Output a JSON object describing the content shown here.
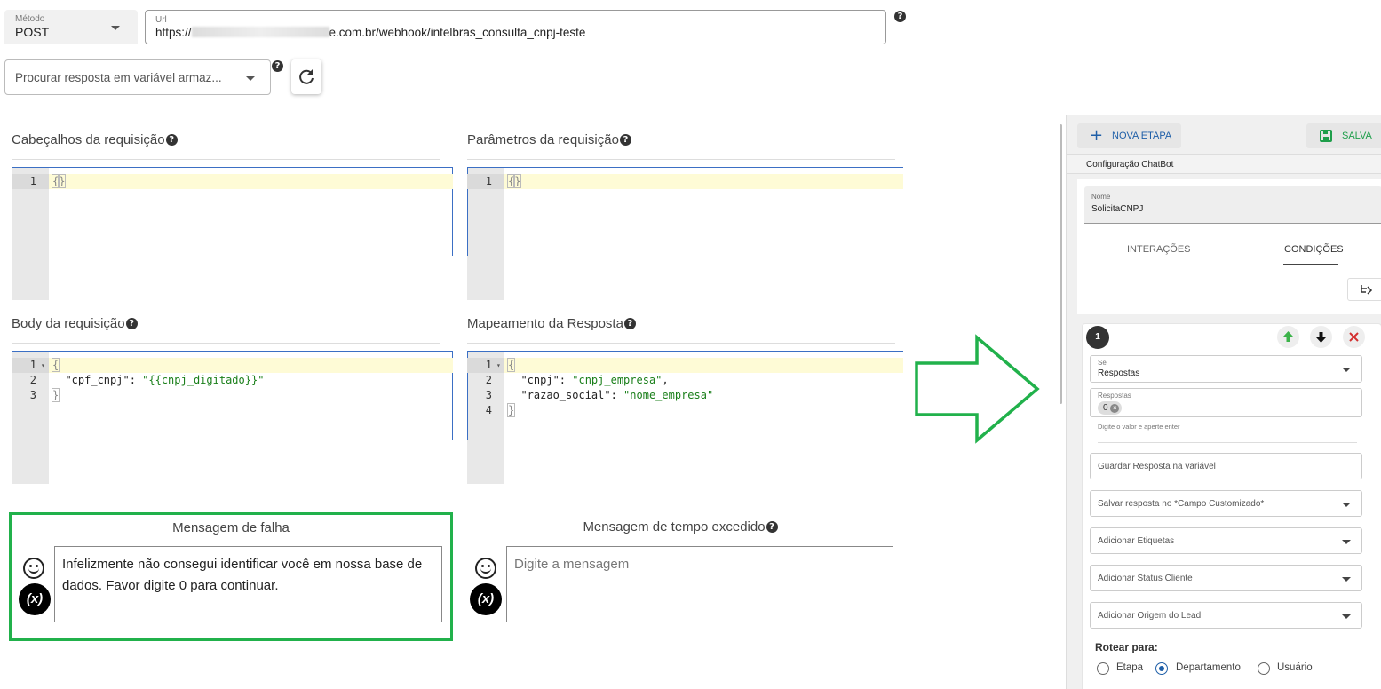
{
  "request": {
    "method_label": "Método",
    "method_value": "POST",
    "url_label": "Url",
    "url_prefix": "https://",
    "url_suffix": "e.com.br/webhook/intelbras_consulta_cnpj-teste",
    "search_placeholder": "Procurar resposta em variável armaz...",
    "help_glyph": "?"
  },
  "sections": {
    "headers_title": "Cabeçalhos da requisição",
    "params_title": "Parâmetros da requisição",
    "body_title": "Body da requisição",
    "mapping_title": "Mapeamento da Resposta"
  },
  "editors": {
    "headers": [
      {
        "n": "1",
        "t": "{}"
      }
    ],
    "params": [
      {
        "n": "1",
        "t": "{}"
      }
    ],
    "body": [
      {
        "n": "1",
        "t": "{"
      },
      {
        "n": "2",
        "k": "  \"cpf_cnpj\": ",
        "v": "\"{{cnpj_digitado}}\""
      },
      {
        "n": "3",
        "t": "}"
      }
    ],
    "mapping": [
      {
        "n": "1",
        "t": "{"
      },
      {
        "n": "2",
        "k": "  \"cnpj\": ",
        "v": "\"cnpj_empresa\"",
        "e": ","
      },
      {
        "n": "3",
        "k": "  \"razao_social\": ",
        "v": "\"nome_empresa\""
      },
      {
        "n": "4",
        "t": "}"
      }
    ]
  },
  "messages": {
    "failure_title": "Mensagem de falha",
    "failure_text": "Infelizmente não consegui identificar você em nossa base de dados. Favor digite 0 para continuar.",
    "timeout_title": "Mensagem de tempo excedido",
    "timeout_placeholder": "Digite a mensagem",
    "var_button": "(x)"
  },
  "panel": {
    "new_step": "NOVA ETAPA",
    "save": "SALVA",
    "config_title": "Configuração ChatBot",
    "name_label": "Nome",
    "name_value": "SolicitaCNPJ",
    "tab_interactions": "INTERAÇÕES",
    "tab_conditions": "CONDIÇÕES",
    "condition_number": "1",
    "if_label": "Se",
    "if_value": "Respostas",
    "answers_label": "Respostas",
    "answer_chip": "0",
    "answers_hint": "Digite o valor e aperte enter",
    "save_var_placeholder": "Guardar Resposta na variável",
    "custom_field_placeholder": "Salvar resposta no *Campo Customizado*",
    "tags_placeholder": "Adicionar Etiquetas",
    "status_placeholder": "Adicionar Status Cliente",
    "origin_placeholder": "Adicionar Origem do Lead",
    "route_label": "Rotear para:",
    "route_options": [
      "Etapa",
      "Departamento",
      "Usuário"
    ],
    "route_selected": "Departamento"
  },
  "colors": {
    "highlight_green": "#21b14b",
    "editor_border": "#3b6fc4",
    "radio_blue": "#1f5fa8",
    "save_green": "#1e9e4a"
  }
}
